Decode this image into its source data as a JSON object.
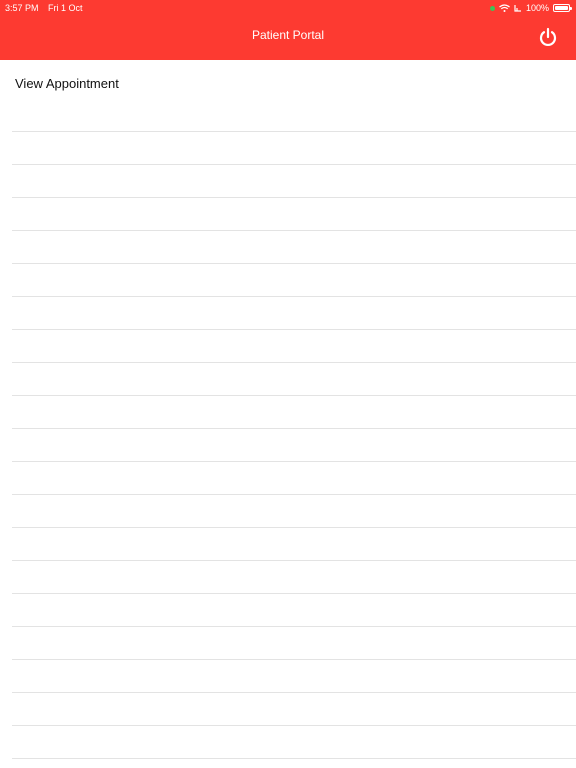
{
  "status_bar": {
    "time": "3:57 PM",
    "date": "Fri 1 Oct",
    "battery": "100%",
    "battery_level": 1.0,
    "icons": [
      "location-icon",
      "wifi-icon",
      "signal-icon",
      "battery-icon"
    ]
  },
  "nav": {
    "title": "Patient Portal",
    "power_icon": "power-icon"
  },
  "content": {
    "heading": "View Appointment"
  },
  "colors": {
    "header": "#fd3a31",
    "separator": "#e3e3e3"
  }
}
